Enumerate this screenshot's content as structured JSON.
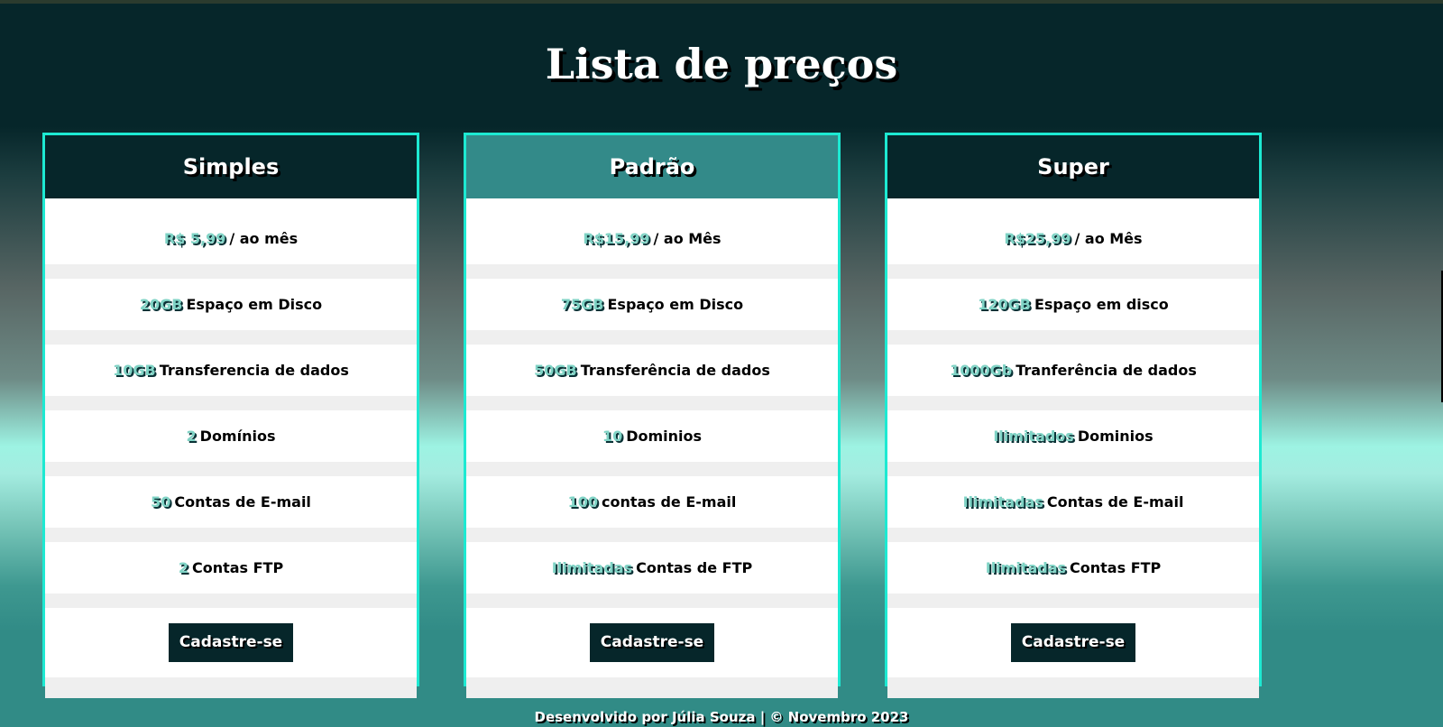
{
  "page": {
    "title": "Lista de preços",
    "footer": "Desenvolvido por Júlia Souza | © Novembro 2023"
  },
  "plans": [
    {
      "name": "Simples",
      "price": {
        "value": "R$ 5,99",
        "suffix": "/ ao mês"
      },
      "disk": {
        "value": "20GB",
        "suffix": "Espaço em Disco"
      },
      "transfer": {
        "value": "10GB",
        "suffix": "Transferencia de dados"
      },
      "domains": {
        "value": "2",
        "suffix": "Domínios"
      },
      "email": {
        "value": "50",
        "suffix": "Contas de E-mail"
      },
      "ftp": {
        "value": "2",
        "suffix": "Contas FTP"
      },
      "button": "Cadastre-se"
    },
    {
      "name": "Padrão",
      "price": {
        "value": "R$15,99",
        "suffix": "/ ao Mês"
      },
      "disk": {
        "value": "75GB",
        "suffix": "Espaço em Disco"
      },
      "transfer": {
        "value": "50GB",
        "suffix": "Transferência de dados"
      },
      "domains": {
        "value": "10",
        "suffix": "Dominios"
      },
      "email": {
        "value": "100",
        "suffix": "contas de E-mail"
      },
      "ftp": {
        "value": "Ilimitadas",
        "suffix": "Contas de FTP"
      },
      "button": "Cadastre-se"
    },
    {
      "name": "Super",
      "price": {
        "value": "R$25,99",
        "suffix": "/ ao Mês"
      },
      "disk": {
        "value": "120GB",
        "suffix": "Espaço em disco"
      },
      "transfer": {
        "value": "1000Gb",
        "suffix": "Tranferência de dados"
      },
      "domains": {
        "value": "Ilimitados",
        "suffix": "Dominios"
      },
      "email": {
        "value": "Ilimitadas",
        "suffix": "Contas de E-mail"
      },
      "ftp": {
        "value": "Ilimitadas",
        "suffix": "Contas FTP"
      },
      "button": "Cadastre-se"
    }
  ],
  "colors": {
    "dark": "#06262a",
    "teal": "#338a89",
    "border": "#1de9d2",
    "highlight": "#7fd3c5"
  }
}
